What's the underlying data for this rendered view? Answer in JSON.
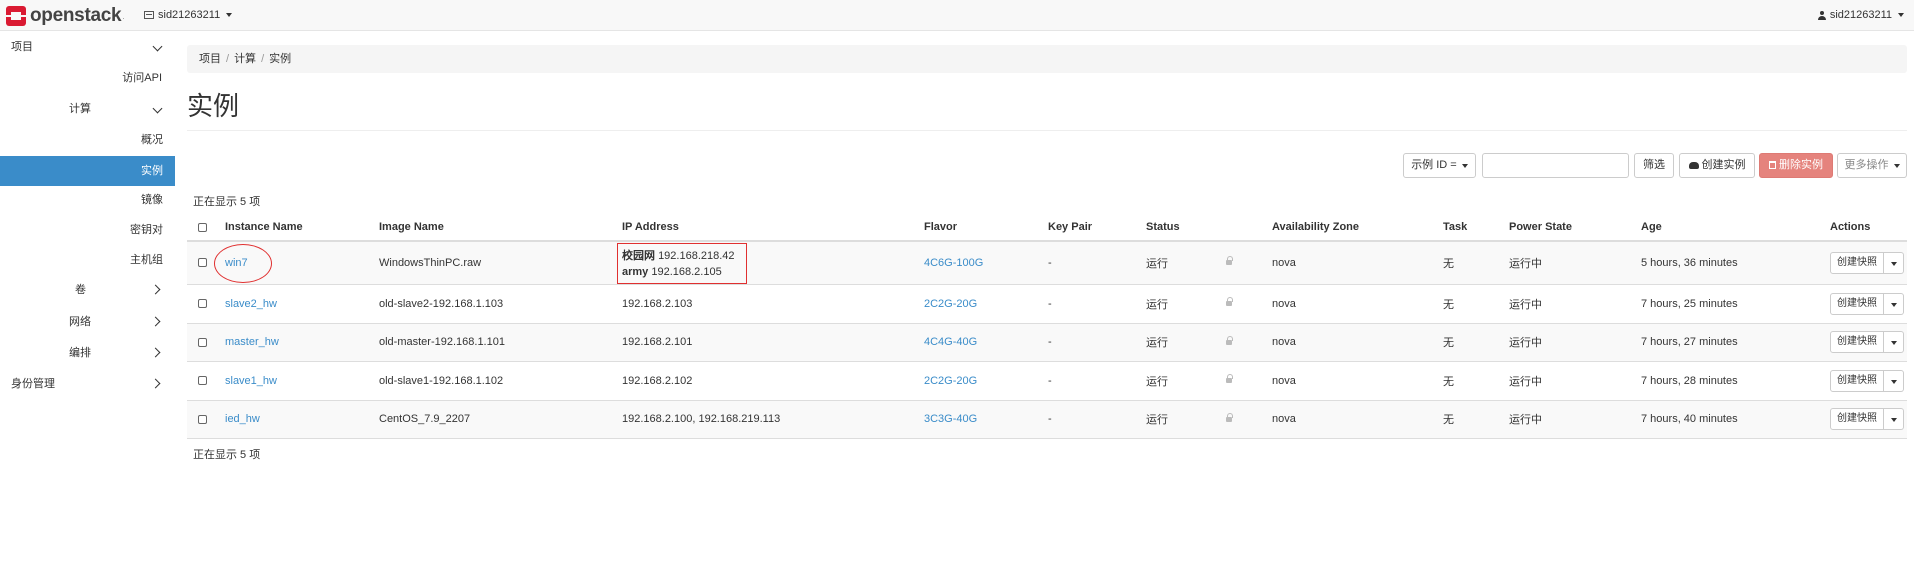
{
  "navbar": {
    "brand": "openstack",
    "brand_dot": ".",
    "project": "sid21263211",
    "user": "sid21263211"
  },
  "sidebar": {
    "project": "项目",
    "access_api": "访问API",
    "compute": "计算",
    "overview": "概况",
    "instances": "实例",
    "images": "镜像",
    "keypairs": "密钥对",
    "server_groups": "主机组",
    "volumes": "卷",
    "network": "网络",
    "orchestration": "编排",
    "identity": "身份管理"
  },
  "breadcrumb": [
    "项目",
    "计算",
    "实例"
  ],
  "page_title": "实例",
  "toolbar": {
    "filter_select": "示例 ID =",
    "filter_value": "",
    "filter_button": "筛选",
    "create_button": "创建实例",
    "delete_button": "删除实例",
    "more_button": "更多操作"
  },
  "count_text": "正在显示 5 项",
  "table": {
    "headers": [
      "Instance Name",
      "Image Name",
      "IP Address",
      "Flavor",
      "Key Pair",
      "Status",
      "Availability Zone",
      "Task",
      "Power State",
      "Age",
      "Actions"
    ],
    "rows": [
      {
        "name": "win7",
        "image": "WindowsThinPC.raw",
        "ip_label1": "校园网",
        "ip1": "192.168.218.42",
        "ip_label2": "army",
        "ip2": "192.168.2.105",
        "flavor": "4C6G-100G",
        "keypair": "-",
        "status": "运行",
        "zone": "nova",
        "task": "无",
        "power": "运行中",
        "age": "5 hours, 36 minutes",
        "action": "创建快照"
      },
      {
        "name": "slave2_hw",
        "image": "old-slave2-192.168.1.103",
        "ip": "192.168.2.103",
        "flavor": "2C2G-20G",
        "keypair": "-",
        "status": "运行",
        "zone": "nova",
        "task": "无",
        "power": "运行中",
        "age": "7 hours, 25 minutes",
        "action": "创建快照"
      },
      {
        "name": "master_hw",
        "image": "old-master-192.168.1.101",
        "ip": "192.168.2.101",
        "flavor": "4C4G-40G",
        "keypair": "-",
        "status": "运行",
        "zone": "nova",
        "task": "无",
        "power": "运行中",
        "age": "7 hours, 27 minutes",
        "action": "创建快照"
      },
      {
        "name": "slave1_hw",
        "image": "old-slave1-192.168.1.102",
        "ip": "192.168.2.102",
        "flavor": "2C2G-20G",
        "keypair": "-",
        "status": "运行",
        "zone": "nova",
        "task": "无",
        "power": "运行中",
        "age": "7 hours, 28 minutes",
        "action": "创建快照"
      },
      {
        "name": "ied_hw",
        "image": "CentOS_7.9_2207",
        "ip": "192.168.2.100, 192.168.219.113",
        "flavor": "3C3G-40G",
        "keypair": "-",
        "status": "运行",
        "zone": "nova",
        "task": "无",
        "power": "运行中",
        "age": "7 hours, 40 minutes",
        "action": "创建快照"
      }
    ]
  },
  "colors": {
    "accent": "#3a8cc9",
    "danger": "#e5837d",
    "annotation": "#e03030"
  }
}
